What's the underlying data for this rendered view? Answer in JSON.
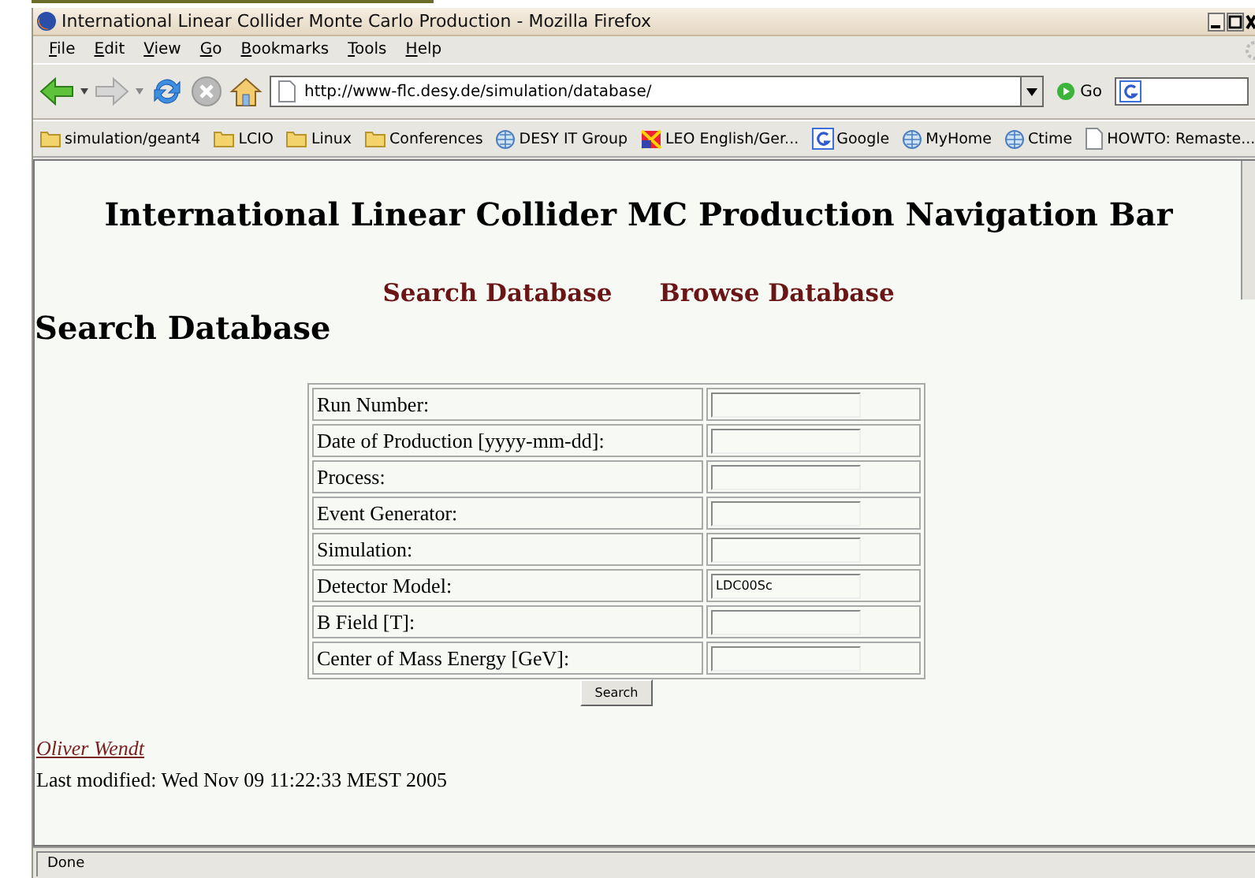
{
  "window": {
    "title": "International Linear Collider Monte Carlo Production - Mozilla Firefox"
  },
  "menu": [
    "File",
    "Edit",
    "View",
    "Go",
    "Bookmarks",
    "Tools",
    "Help"
  ],
  "toolbar": {
    "url": "http://www-flc.desy.de/simulation/database/",
    "go_label": "Go"
  },
  "bookmarks": [
    {
      "kind": "folder",
      "label": "simulation/geant4"
    },
    {
      "kind": "folder",
      "label": "LCIO"
    },
    {
      "kind": "folder",
      "label": "Linux"
    },
    {
      "kind": "folder",
      "label": "Conferences"
    },
    {
      "kind": "site",
      "label": "DESY IT Group"
    },
    {
      "kind": "flag",
      "label": "LEO English/Ger..."
    },
    {
      "kind": "google",
      "label": "Google"
    },
    {
      "kind": "site",
      "label": "MyHome"
    },
    {
      "kind": "site",
      "label": "Ctime"
    },
    {
      "kind": "page",
      "label": "HOWTO: Remaste..."
    }
  ],
  "page": {
    "banner": "International Linear Collider MC Production Navigation Bar",
    "nav_links": [
      "Search Database",
      "Browse Database"
    ],
    "heading": "Search Database",
    "fields": [
      {
        "label": "Run Number:"
      },
      {
        "label": "Date of Production [yyyy-mm-dd]:"
      },
      {
        "label": "Process:"
      },
      {
        "label": "Event Generator:"
      },
      {
        "label": "Simulation:"
      },
      {
        "label": "Detector Model:",
        "value": "LDC00Sc"
      },
      {
        "label": "B Field [T]:"
      },
      {
        "label": "Center of Mass Energy [GeV]:"
      }
    ],
    "button": "Search",
    "author": "Oliver Wendt",
    "last_modified": "Last modified: Wed Nov 09 11:22:33 MEST 2005"
  },
  "status_bar": "Done"
}
